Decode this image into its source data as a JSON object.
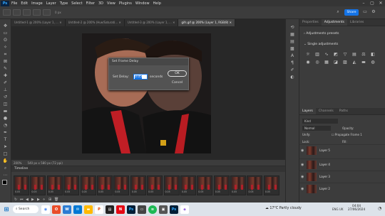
{
  "menubar": {
    "logo": "Ps",
    "items": [
      "File",
      "Edit",
      "Image",
      "Layer",
      "Type",
      "Select",
      "Filter",
      "3D",
      "View",
      "Plugins",
      "Window",
      "Help"
    ]
  },
  "optbar": {
    "share_label": "Share",
    "feather": "0 px"
  },
  "tabs": [
    {
      "label": "Untitled-1 @ 200% (Layer 1, ...",
      "active": false
    },
    {
      "label": "Untitled-2 @ 200% (Hue/Saturati...",
      "active": false
    },
    {
      "label": "Untitled-3 @ 200% (Layer 1, ...",
      "active": false
    },
    {
      "label": "gifs.gif @ 200% (Layer 1, RGB/8)",
      "active": true
    }
  ],
  "status": {
    "zoom": "200%",
    "dims": "540 px x 580 px (72 ppi)"
  },
  "dialog": {
    "title": "Set Frame Delay",
    "delay_label": "Set Delay:",
    "delay_value": "0.05",
    "unit": "seconds",
    "ok": "OK",
    "cancel": "Cancel"
  },
  "timeline": {
    "title": "Timeline",
    "frames": [
      "0.05",
      "0.05",
      "0.05",
      "0.05",
      "0.05",
      "0.05",
      "0.05",
      "0.05",
      "0.05",
      "0.05",
      "0.05",
      "0.05",
      "0.05",
      "0.05",
      "0.05",
      "0.05"
    ]
  },
  "rightpanel": {
    "tabs_top": [
      {
        "label": "Properties",
        "active": false
      },
      {
        "label": "Adjustments",
        "active": true
      },
      {
        "label": "Libraries",
        "active": false
      }
    ],
    "presets_label": "Adjustments presets",
    "single_label": "Single adjustments",
    "tabs_layers": [
      {
        "label": "Layers",
        "active": true
      },
      {
        "label": "Channels",
        "active": false
      },
      {
        "label": "Paths",
        "active": false
      }
    ],
    "kind": "Kind",
    "blend": "Normal",
    "opacity_label": "Opacity:",
    "unify_label": "Unify:",
    "propagate_label": "Propagate Frame 1",
    "lock_label": "Lock:",
    "fill_label": "Fill:",
    "layers": [
      "Layer 5",
      "Layer 4",
      "Layer 3",
      "Layer 2"
    ]
  },
  "taskbar": {
    "search": "Search",
    "weather": "17°C  Partly cloudy",
    "time": "04:04",
    "date": "27/06/2024",
    "lang": "ENG UK"
  }
}
